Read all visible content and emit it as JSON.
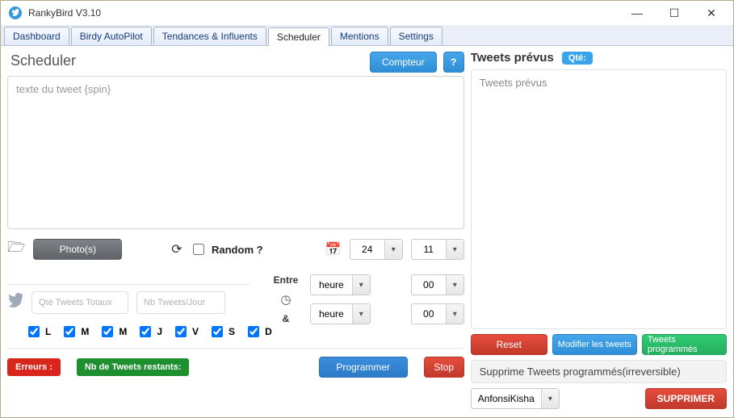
{
  "window": {
    "title": "RankyBird V3.10"
  },
  "tabs": [
    "Dashboard",
    "Birdy AutoPilot",
    "Tendances & Influents",
    "Scheduler",
    "Mentions",
    "Settings"
  ],
  "activeTab": 3,
  "scheduler": {
    "title": "Scheduler",
    "compteur": "Compteur",
    "help": "?",
    "placeholder": "texte du tweet {spin}",
    "photos": "Photo(s)",
    "random": "Random ?",
    "dateHour": "24",
    "dateMin": "11",
    "entre": "Entre",
    "amp": "&",
    "heure": "heure",
    "zero": "00",
    "qteTotaux": "Qté Tweets Totaux",
    "nbJour": "Nb Tweets/Jour",
    "days": [
      "L",
      "M",
      "M",
      "J",
      "V",
      "S",
      "D"
    ],
    "erreurs": "Erreurs :",
    "restants": "Nb de Tweets restants:",
    "programmer": "Programmer",
    "stop": "Stop"
  },
  "planned": {
    "title": "Tweets prévus",
    "qte": "Qté:",
    "placeholder": "Tweets prévus",
    "reset": "Reset",
    "modifier": "Modifier les tweets",
    "programmes": "Tweets programmés",
    "supprimeTitle": "Supprime Tweets programmés(irreversible)",
    "account": "AnfonsiKisha",
    "supprimer": "SUPPRIMER"
  }
}
